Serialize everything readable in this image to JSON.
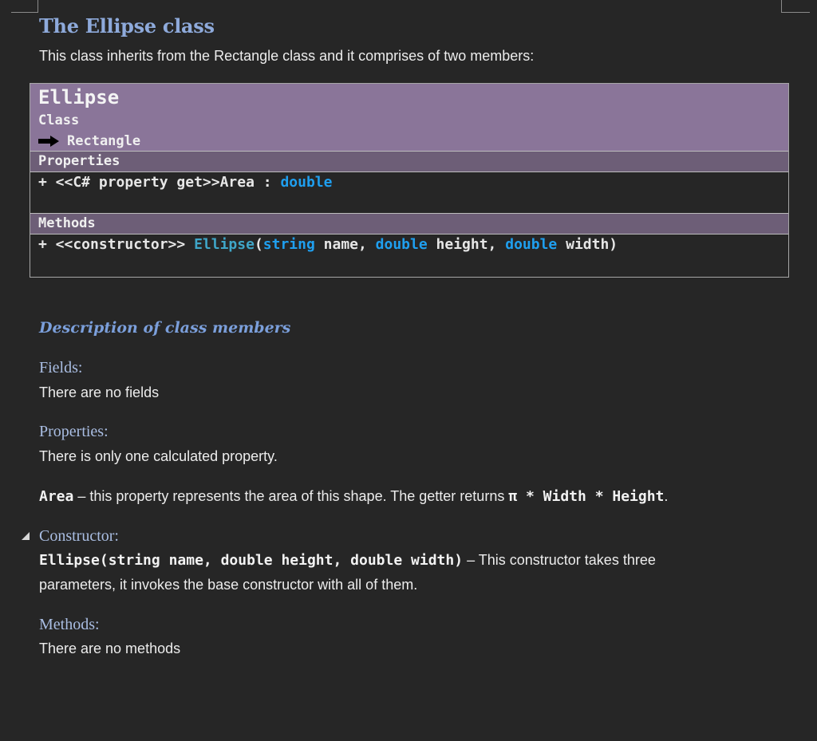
{
  "document": {
    "title": "The Ellipse class",
    "intro": "This class inherits from the Rectangle class and it comprises of two members:"
  },
  "class_box": {
    "name": "Ellipse",
    "kind": "Class",
    "parent": "Rectangle",
    "parent_icon": "right-arrow-icon",
    "sections": {
      "properties_label": "Properties",
      "methods_label": "Methods"
    },
    "property": {
      "prefix": "+ <<C# property get>>Area : ",
      "type": "double"
    },
    "method": {
      "prefix": "+ <<constructor>> ",
      "name": "Ellipse",
      "open": "(",
      "p1_type": "string",
      "p1_name": " name, ",
      "p2_type": "double",
      "p2_name": " height, ",
      "p3_type": "double",
      "p3_name": " width)"
    }
  },
  "description": {
    "heading": "Description of class members",
    "fields": {
      "heading": "Fields:",
      "text": "There are no fields"
    },
    "properties": {
      "heading": "Properties:",
      "text": "There is only one calculated property.",
      "area_name": "Area",
      "area_text": " – this property represents the area of this shape. The getter returns ",
      "area_formula": "π * Width * Height",
      "area_end": "."
    },
    "constructor": {
      "heading": "Constructor:",
      "collapse_icon": "collapse-triangle-icon",
      "sig_name": "Ellipse",
      "sig_open": "(",
      "p1_type": "string",
      "p1_name": " name, ",
      "p2_type": "double",
      "p2_name": " height, ",
      "p3_type": "double",
      "p3_name": " width)",
      "text_line1": " – This constructor takes three",
      "text_line2": "parameters, it invokes the base constructor with all of them."
    },
    "methods": {
      "heading": "Methods:",
      "text": "There are no methods"
    }
  },
  "colors": {
    "background": "#262626",
    "title": "#8eaadb",
    "header_fill": "#8a7599",
    "section_fill": "#6d5e77",
    "keyword": "#1f9fef",
    "class_name": "#3fa6c8"
  }
}
